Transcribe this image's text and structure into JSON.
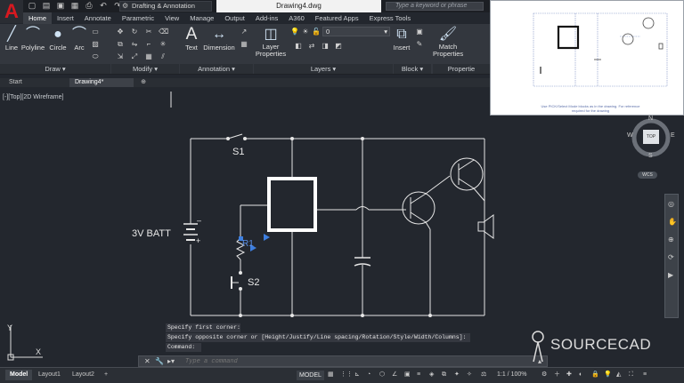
{
  "app": {
    "logo_letter": "A",
    "workspace": "Drafting & Annotation",
    "document_title": "Drawing4.dwg",
    "search_placeholder": "Type a keyword or phrase"
  },
  "ribbon_tabs": [
    "Home",
    "Insert",
    "Annotate",
    "Parametric",
    "View",
    "Manage",
    "Output",
    "Add-ins",
    "A360",
    "Featured Apps",
    "Express Tools"
  ],
  "draw_panel": {
    "tools": [
      {
        "label": "Line",
        "icon": "line-icon"
      },
      {
        "label": "Polyline",
        "icon": "polyline-icon"
      },
      {
        "label": "Circle",
        "icon": "circle-icon"
      },
      {
        "label": "Arc",
        "icon": "arc-icon"
      }
    ],
    "title": "Draw"
  },
  "modify_panel": {
    "title": "Modify"
  },
  "annotation_panel": {
    "tools": [
      {
        "label": "Text",
        "icon": "text-icon"
      },
      {
        "label": "Dimension",
        "icon": "dimension-icon"
      }
    ],
    "title": "Annotation"
  },
  "layers_panel": {
    "layer_properties_line1": "Layer",
    "layer_properties_line2": "Properties",
    "current_layer": "0",
    "title": "Layers"
  },
  "block_panel": {
    "insert_label": "Insert",
    "title": "Block"
  },
  "properties_panel": {
    "match_line1": "Match",
    "match_line2": "Properties",
    "title": "Propertie"
  },
  "doc_tabs": [
    {
      "label": "Start",
      "active": false
    },
    {
      "label": "Drawing4*",
      "active": true
    }
  ],
  "viewport_label": "[-][Top][2D Wireframe]",
  "schematic": {
    "battery_label": "3V BATT",
    "switch1_label": "S1",
    "switch2_label": "S2",
    "resistor_label": "R1",
    "battery_minus": "–",
    "battery_plus": "+"
  },
  "inset_note": "Use PICK/Select Mode blocks as in the drawing. For reference required for the drawing",
  "viewcube": {
    "top_face": "TOP",
    "north": "N",
    "south": "S",
    "west": "W",
    "east": "E",
    "wcs": "WCS"
  },
  "command": {
    "history": [
      "Specify first corner:",
      "Specify opposite corner or [Height/Justify/Line spacing/Rotation/Style/Width/Columns]:",
      "Command:"
    ],
    "placeholder": "Type a command"
  },
  "ucs": {
    "x": "X",
    "y": "Y"
  },
  "brand": "SOURCECAD",
  "layout_tabs": [
    {
      "label": "Model",
      "active": true
    },
    {
      "label": "Layout1",
      "active": false
    },
    {
      "label": "Layout2",
      "active": false
    },
    {
      "label": "+",
      "active": false
    }
  ],
  "status": {
    "model_badge": "MODEL",
    "scale": "1:1 / 100%"
  }
}
